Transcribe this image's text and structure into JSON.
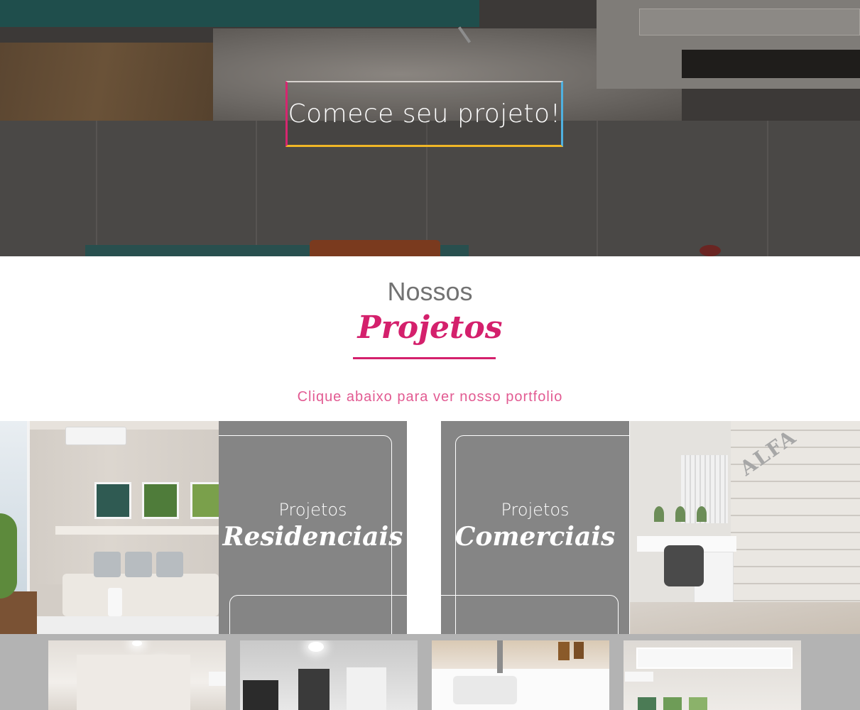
{
  "hero": {
    "cta_label": "Comece seu projeto!",
    "cta_border_colors": [
      "#d6266f",
      "#f0b626",
      "#4fb1e0"
    ]
  },
  "projects_section": {
    "title_small": "Nossos",
    "title_big": "Projetos",
    "subtitle": "Clique abaixo para ver nosso portfolio",
    "accent_color": "#d4206c",
    "cards": [
      {
        "small": "Projetos",
        "big": "Residenciais"
      },
      {
        "small": "Projetos",
        "big": "Comerciais"
      }
    ],
    "office_logo": "ALFA"
  },
  "gallery": {
    "thumbnails": [
      "bedroom-render",
      "bedroom-render-2",
      "bathroom-render",
      "living-room-render"
    ]
  }
}
